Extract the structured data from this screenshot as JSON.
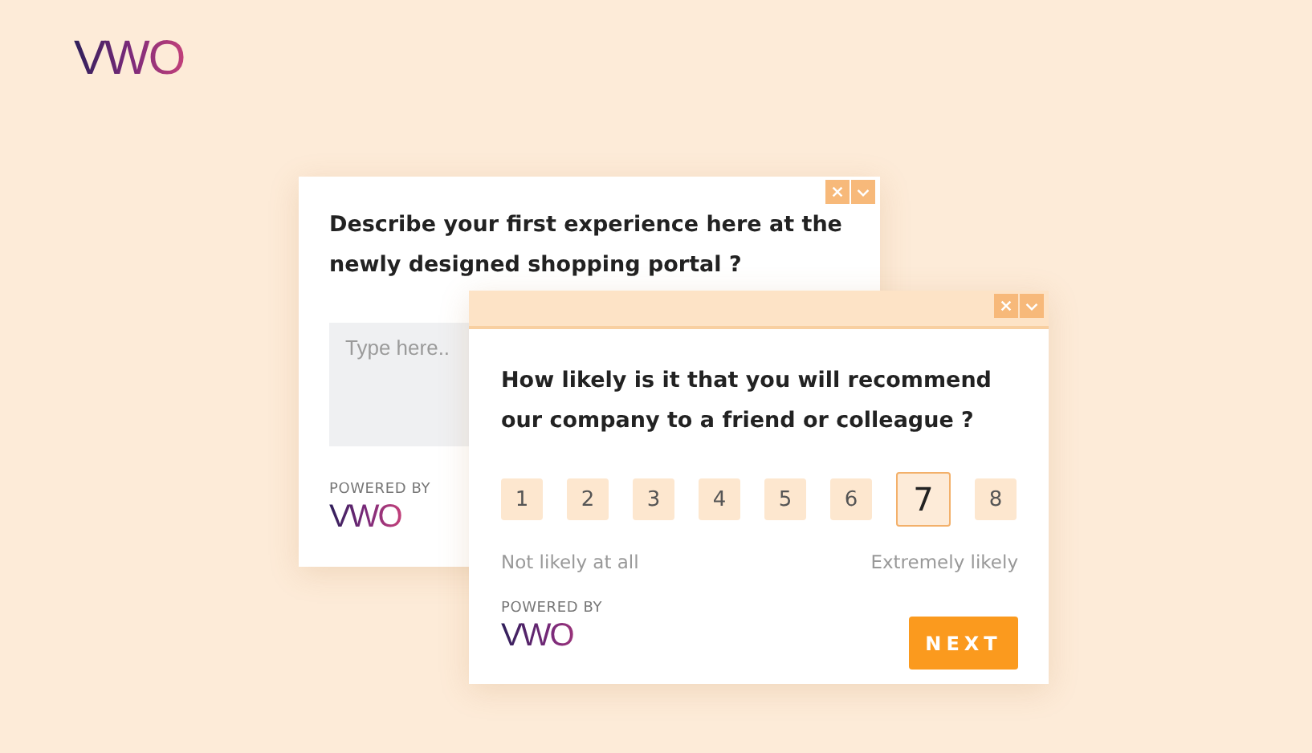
{
  "logo": "VWO",
  "cards": [
    {
      "kind": "text",
      "question": "Describe your first experience here at the newly designed shopping portal ?",
      "placeholder": "Type here..",
      "powered_by": "POWERED BY",
      "logo": "VWO"
    },
    {
      "kind": "rating",
      "question": "How likely is it that you will recommend our company to a friend or colleague ?",
      "scale": [
        {
          "label": "1",
          "selected": false
        },
        {
          "label": "2",
          "selected": false
        },
        {
          "label": "3",
          "selected": false
        },
        {
          "label": "4",
          "selected": false
        },
        {
          "label": "5",
          "selected": false
        },
        {
          "label": "6",
          "selected": false
        },
        {
          "label": "7",
          "selected": true
        },
        {
          "label": "8",
          "selected": false
        }
      ],
      "low_label": "Not likely at all",
      "high_label": "Extremely likely",
      "powered_by": "POWERED BY",
      "logo": "VWO",
      "button": "NEXT"
    }
  ]
}
